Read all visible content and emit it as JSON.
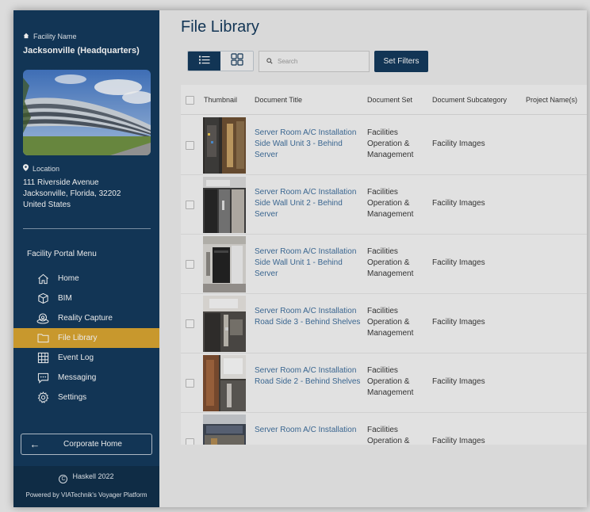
{
  "sidebar": {
    "facility_label": "Facility Name",
    "facility_name": "Jacksonville (Headquarters)",
    "location_label": "Location",
    "address_line1": "111 Riverside Avenue",
    "address_line2": "Jacksonville, Florida, 32202",
    "address_line3": "United States",
    "menu_title": "Facility Portal Menu",
    "menu": [
      {
        "label": "Home",
        "icon": "home-icon",
        "active": false
      },
      {
        "label": "BIM",
        "icon": "cube-icon",
        "active": false
      },
      {
        "label": "Reality Capture",
        "icon": "camera-360-icon",
        "active": false
      },
      {
        "label": "File Library",
        "icon": "folder-icon",
        "active": true
      },
      {
        "label": "Event Log",
        "icon": "grid-table-icon",
        "active": false
      },
      {
        "label": "Messaging",
        "icon": "chat-icon",
        "active": false
      },
      {
        "label": "Settings",
        "icon": "gear-icon",
        "active": false
      }
    ],
    "corporate_home": "Corporate Home",
    "copyright": "Haskell 2022",
    "powered_by": "Powered by VIATechnik's Voyager Platform",
    "accent_color": "#d9a32c",
    "bg_color": "#0e3558"
  },
  "main": {
    "title": "File Library",
    "search_placeholder": "Search",
    "set_filters": "Set Filters",
    "columns": [
      "Thumbnail",
      "Document Title",
      "Document Set",
      "Document Subcategory",
      "Project Name(s)"
    ],
    "rows": [
      {
        "title": "Server Room A/C Installation Side Wall Unit 3 - Behind Server",
        "set": "Facilities Operation & Management",
        "subcategory": "Facility Images"
      },
      {
        "title": "Server Room A/C Installation Side Wall Unit 2 - Behind Server",
        "set": "Facilities Operation & Management",
        "subcategory": "Facility Images"
      },
      {
        "title": "Server Room A/C Installation Side Wall Unit 1 - Behind Server",
        "set": "Facilities Operation & Management",
        "subcategory": "Facility Images"
      },
      {
        "title": "Server Room A/C Installation Road Side 3 - Behind Shelves",
        "set": "Facilities Operation & Management",
        "subcategory": "Facility Images"
      },
      {
        "title": "Server Room A/C Installation Road Side 2 - Behind Shelves",
        "set": "Facilities Operation & Management",
        "subcategory": "Facility Images"
      },
      {
        "title": "Server Room A/C Installation",
        "set": "Facilities Operation &",
        "subcategory": "Facility Images"
      }
    ]
  }
}
